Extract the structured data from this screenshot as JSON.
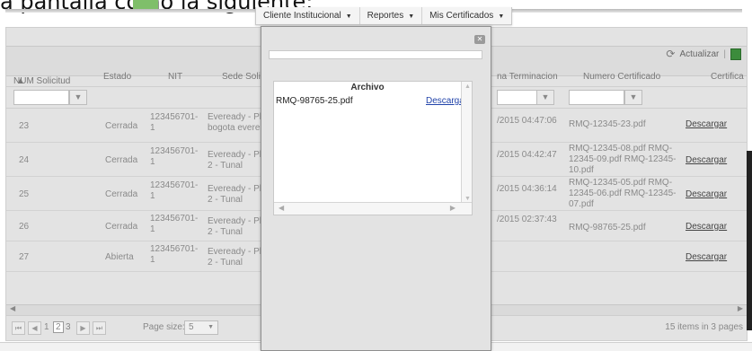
{
  "caption": "a pantalla como la siguiente:",
  "nav": {
    "menus": [
      "Cliente Institucional",
      "Reportes",
      "Mis Certificados"
    ]
  },
  "toolbar": {
    "refresh_label": "Actualizar",
    "separator": "|"
  },
  "columns": {
    "num": "NUM Solicitud",
    "estado": "Estado",
    "nit": "NIT",
    "sede": "Sede Soli",
    "fecha_term": "na Terminacion",
    "num_cert": "Numero Certificado",
    "cert": "Certifica"
  },
  "rows": [
    {
      "num": "23",
      "estado": "Cerrada",
      "nit": "123456701-\n1",
      "sede": "Eveready - Pl\nbogota evere",
      "fecha": "/2015 04:47:06",
      "cert": "RMQ-12345-23.pdf",
      "link": "Descargar"
    },
    {
      "num": "24",
      "estado": "Cerrada",
      "nit": "123456701-\n1",
      "sede": "Eveready - Pl\n2 - Tunal",
      "fecha": "/2015 04:42:47",
      "cert": "RMQ-12345-08.pdf RMQ-\n12345-09.pdf RMQ-12345-\n10.pdf",
      "link": "Descargar"
    },
    {
      "num": "25",
      "estado": "Cerrada",
      "nit": "123456701-\n1",
      "sede": "Eveready - Pl\n2 - Tunal",
      "fecha": "/2015 04:36:14",
      "cert": "RMQ-12345-05.pdf RMQ-\n12345-06.pdf RMQ-12345-\n07.pdf",
      "link": "Descargar"
    },
    {
      "num": "26",
      "estado": "Cerrada",
      "nit": "123456701-\n1",
      "sede": "Eveready - Pl\n2 - Tunal",
      "fecha": "/2015 02:37:43",
      "cert": "RMQ-98765-25.pdf",
      "link": "Descargar"
    },
    {
      "num": "27",
      "estado": "Abierta",
      "nit": "123456701-\n1",
      "sede": "Eveready - Pl\n2 - Tunal",
      "fecha": "",
      "cert": "",
      "link": "Descargar"
    }
  ],
  "pager": {
    "pages": [
      "1",
      "2",
      "3"
    ],
    "current": "2",
    "page_size_label": "Page size:",
    "page_size": "5",
    "items_info": "15 items in 3 pages"
  },
  "modal": {
    "header": "Archivo",
    "file": "RMQ-98765-25.pdf",
    "link": "Descargar"
  }
}
